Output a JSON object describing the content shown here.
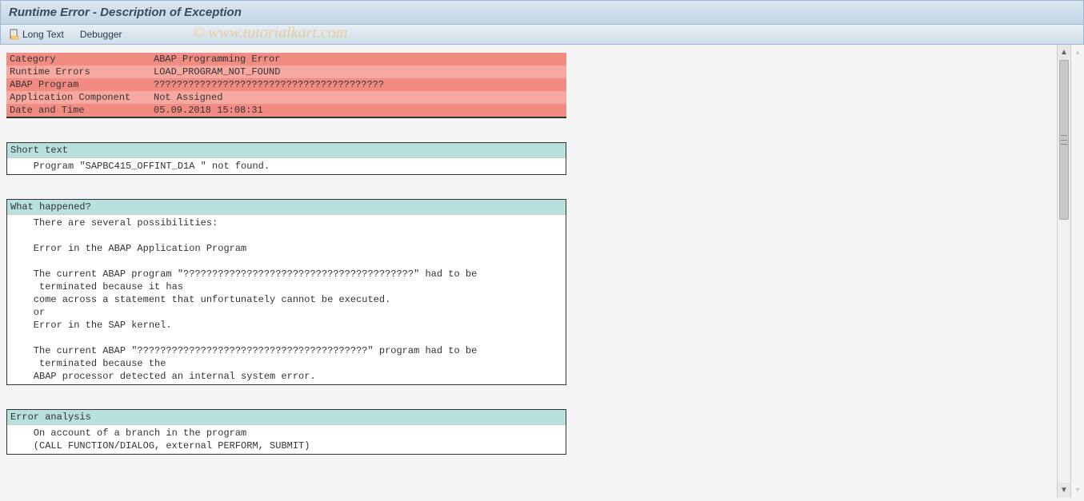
{
  "title": "Runtime Error - Description of Exception",
  "toolbar": {
    "long_text": "Long Text",
    "debugger": "Debugger"
  },
  "watermark": "© www.tutorialkart.com",
  "info": {
    "rows": [
      {
        "label": "Category",
        "value": "ABAP Programming Error"
      },
      {
        "label": "Runtime Errors",
        "value": "LOAD_PROGRAM_NOT_FOUND"
      },
      {
        "label": "ABAP Program",
        "value": "????????????????????????????????????????"
      },
      {
        "label": "Application Component",
        "value": "Not Assigned"
      },
      {
        "label": "Date and Time",
        "value": "05.09.2018 15:08:31"
      }
    ]
  },
  "sections": [
    {
      "header": "Short text",
      "lines": [
        "    Program \"SAPBC415_OFFINT_D1A \" not found."
      ]
    },
    {
      "header": "What happened?",
      "lines": [
        "    There are several possibilities:",
        "",
        "    Error in the ABAP Application Program",
        "",
        "    The current ABAP program \"????????????????????????????????????????\" had to be",
        "     terminated because it has",
        "    come across a statement that unfortunately cannot be executed.",
        "    or",
        "    Error in the SAP kernel.",
        "",
        "    The current ABAP \"????????????????????????????????????????\" program had to be",
        "     terminated because the",
        "    ABAP processor detected an internal system error."
      ]
    },
    {
      "header": "Error analysis",
      "lines": [
        "    On account of a branch in the program",
        "    (CALL FUNCTION/DIALOG, external PERFORM, SUBMIT)"
      ]
    }
  ]
}
